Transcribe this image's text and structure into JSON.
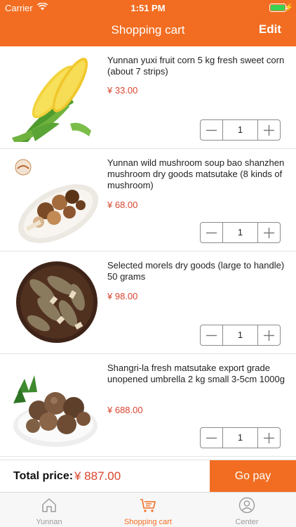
{
  "status_bar": {
    "carrier": "Carrier",
    "time": "1:51 PM",
    "battery_level": 1.0
  },
  "header": {
    "title": "Shopping cart",
    "edit_label": "Edit"
  },
  "items": [
    {
      "title": "Yunnan yuxi fruit corn 5 kg fresh sweet corn (about 7 strips)",
      "price": "¥ 33.00",
      "quantity": "1",
      "image": "corn-photo"
    },
    {
      "title": "Yunnan wild mushroom soup bao shanzhen mushroom dry goods matsutake (8 kinds of mushroom)",
      "price": "¥ 68.00",
      "quantity": "1",
      "image": "dried-mushroom-photo"
    },
    {
      "title": "Selected morels dry goods (large to handle) 50 grams",
      "price": "¥ 98.00",
      "quantity": "1",
      "image": "morels-photo"
    },
    {
      "title": "Shangri-la fresh matsutake export grade unopened umbrella 2 kg small 3-5cm 1000g",
      "price": "¥ 688.00",
      "quantity": "1",
      "image": "matsutake-photo"
    }
  ],
  "checkout": {
    "total_label": "Total price:",
    "total_value": "¥ 887.00",
    "pay_label": "Go pay"
  },
  "tabs": [
    {
      "label": "Yunnan",
      "icon": "home-icon",
      "active": false
    },
    {
      "label": "Shopping cart",
      "icon": "cart-icon",
      "active": true
    },
    {
      "label": "Center",
      "icon": "user-icon",
      "active": false
    }
  ],
  "colors": {
    "accent": "#f26d21",
    "price": "#d8442e"
  }
}
